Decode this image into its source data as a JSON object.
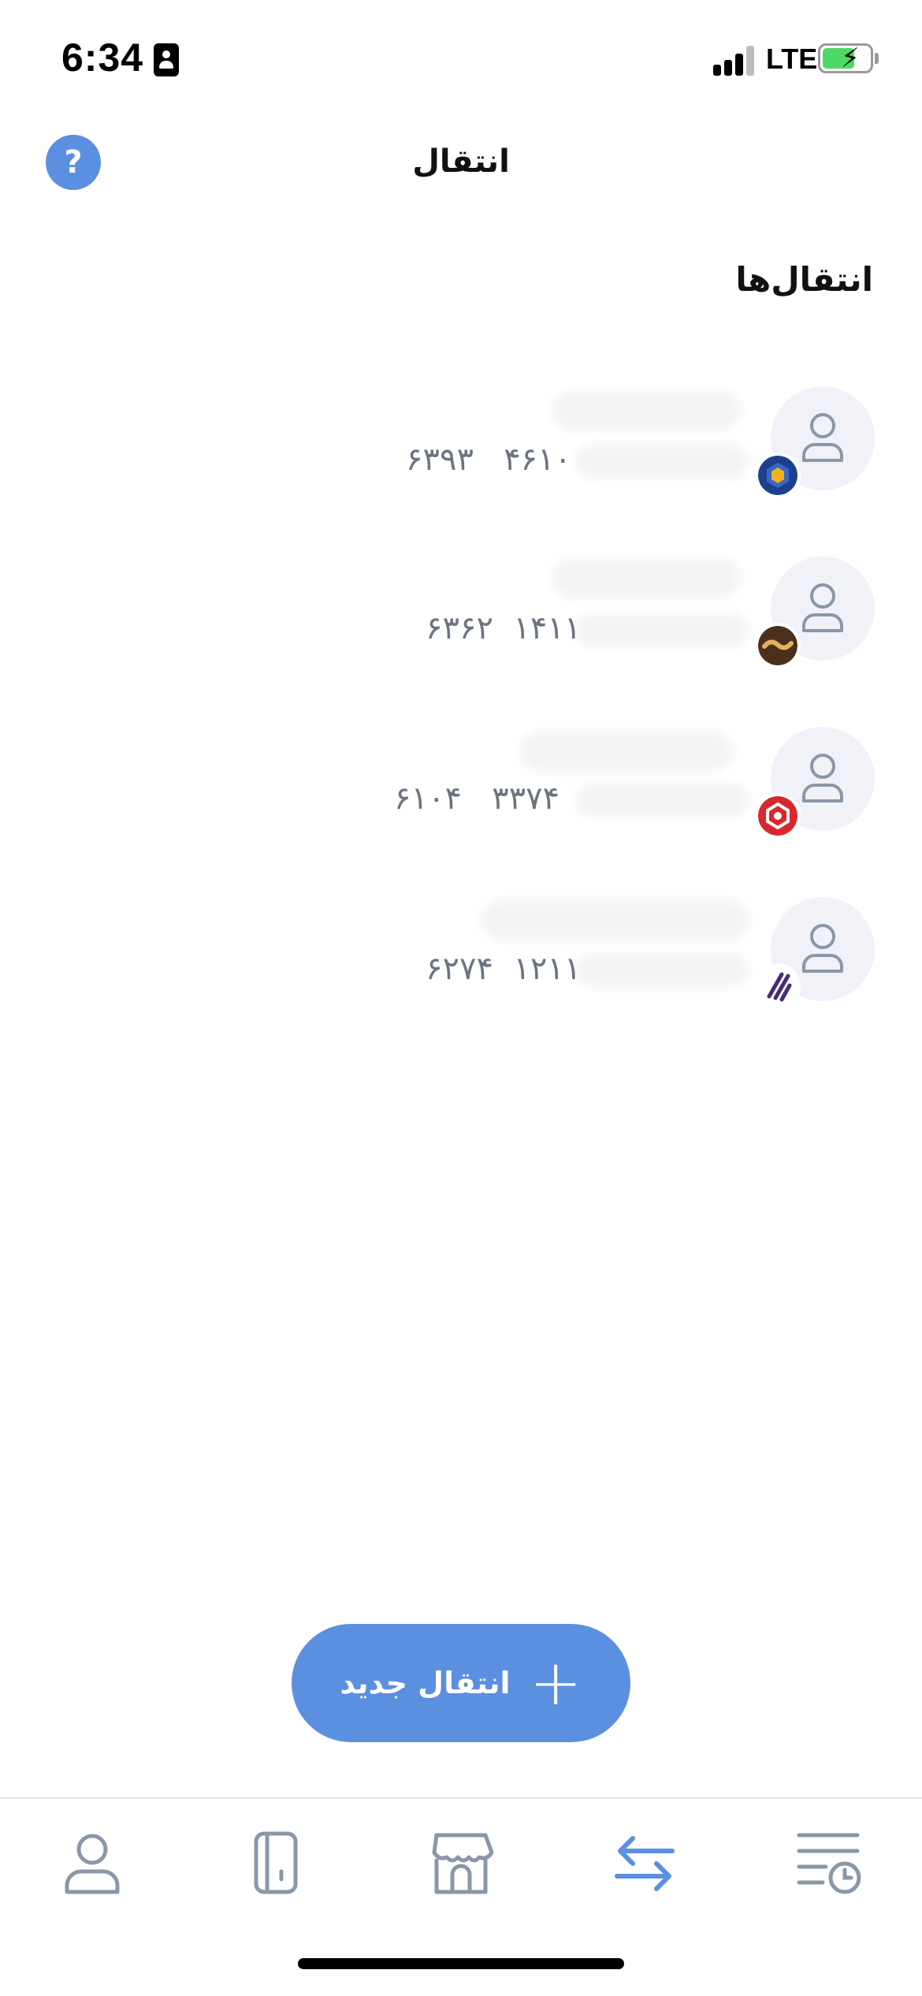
{
  "status_bar": {
    "time": "6:34",
    "network": "LTE"
  },
  "header": {
    "title": "انتقال",
    "help_label": "?"
  },
  "section": {
    "title": "انتقال‌ها"
  },
  "transfers": [
    {
      "card_last": "۴۶۱۰",
      "card_first": "۶۳۹۳",
      "bank_icon": "bank-logo-blue-hexagon"
    },
    {
      "card_last": "۱۴۱۱",
      "card_first": "۶۳۶۲",
      "bank_icon": "bank-logo-brown-wave"
    },
    {
      "card_last": "۳۳۷۴",
      "card_first": "۶۱۰۴",
      "bank_icon": "bank-logo-red"
    },
    {
      "card_last": "۱۲۱۱",
      "card_first": "۶۲۷۴",
      "bank_icon": "bank-logo-purple"
    }
  ],
  "fab": {
    "label": "انتقال جدید",
    "icon": "plus-icon"
  },
  "bottom_nav": {
    "items": [
      {
        "icon": "profile-icon",
        "active": false
      },
      {
        "icon": "card-icon",
        "active": false
      },
      {
        "icon": "store-icon",
        "active": false
      },
      {
        "icon": "transfer-icon",
        "active": true
      },
      {
        "icon": "history-icon",
        "active": false
      }
    ]
  },
  "colors": {
    "accent": "#5b8fe0",
    "inactive": "#8a97a8",
    "avatar_bg": "#f0f2f7",
    "text_muted": "#6b7480"
  }
}
